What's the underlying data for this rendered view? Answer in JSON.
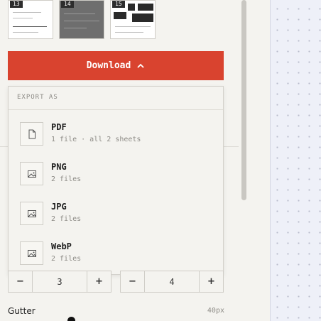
{
  "thumbnails": [
    {
      "number": "13"
    },
    {
      "number": "14"
    },
    {
      "number": "15"
    }
  ],
  "download": {
    "label": "Download",
    "icon": "chevron-up-icon",
    "color": "#d9432f"
  },
  "export_menu": {
    "heading": "EXPORT AS",
    "items": [
      {
        "title": "PDF",
        "subtitle": "1 file · all 2 sheets",
        "icon": "file-icon"
      },
      {
        "title": "PNG",
        "subtitle": "2 files",
        "icon": "image-icon"
      },
      {
        "title": "JPG",
        "subtitle": "2 files",
        "icon": "image-icon"
      },
      {
        "title": "WebP",
        "subtitle": "2 files",
        "icon": "image-icon"
      }
    ]
  },
  "steppers": [
    {
      "minus": "−",
      "value": "3",
      "plus": "+"
    },
    {
      "minus": "−",
      "value": "4",
      "plus": "+"
    }
  ],
  "gutter": {
    "label": "Gutter",
    "value": "40px"
  }
}
